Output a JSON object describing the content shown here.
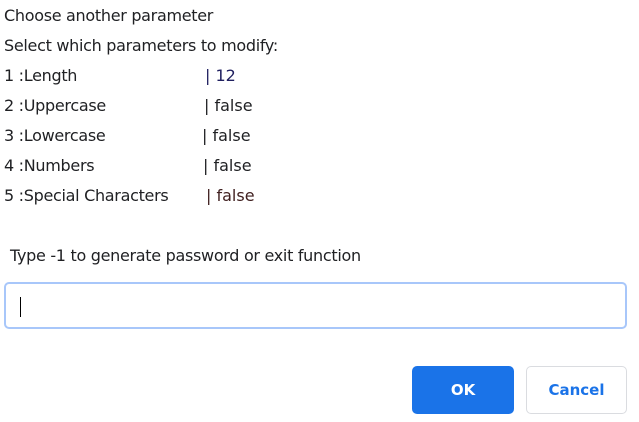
{
  "message": {
    "line1": "Choose another parameter",
    "line2": "Select which parameters to modify:",
    "params": [
      {
        "label": "1 :Length",
        "value": "| 12"
      },
      {
        "label": "2 :Uppercase",
        "value": "| false"
      },
      {
        "label": "3 :Lowercase",
        "value": "| false"
      },
      {
        "label": "4 :Numbers",
        "value": "| false"
      },
      {
        "label": "5 :Special Characters",
        "value": "| false"
      }
    ]
  },
  "prompt": {
    "label": "Type -1 to generate password or exit function",
    "value": ""
  },
  "buttons": {
    "ok": "OK",
    "cancel": "Cancel"
  },
  "colors": {
    "accent": "#1a73e8",
    "input_border": "#a8c7fa"
  }
}
